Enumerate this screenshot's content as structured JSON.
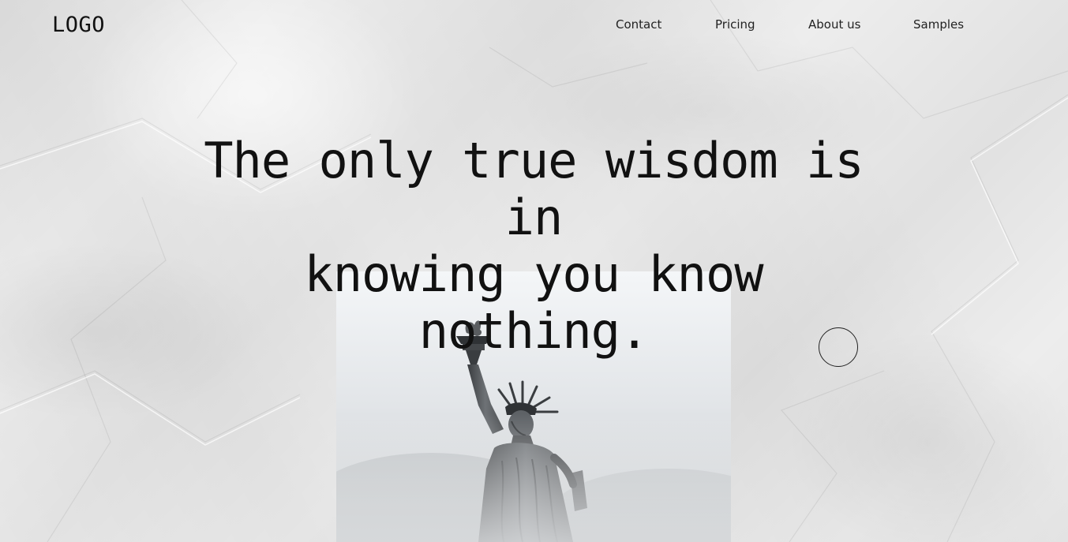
{
  "header": {
    "logo": "LOGO",
    "nav": [
      {
        "label": "Contact"
      },
      {
        "label": "Pricing"
      },
      {
        "label": "About us"
      },
      {
        "label": "Samples"
      }
    ]
  },
  "hero": {
    "quote_lines": [
      "The only true wisdom is in",
      "knowing you know",
      "nothing."
    ],
    "image": {
      "subject": "statue-of-liberty",
      "icon": "statue-image"
    }
  },
  "colors": {
    "text": "#111111",
    "paper": "#ededed"
  }
}
